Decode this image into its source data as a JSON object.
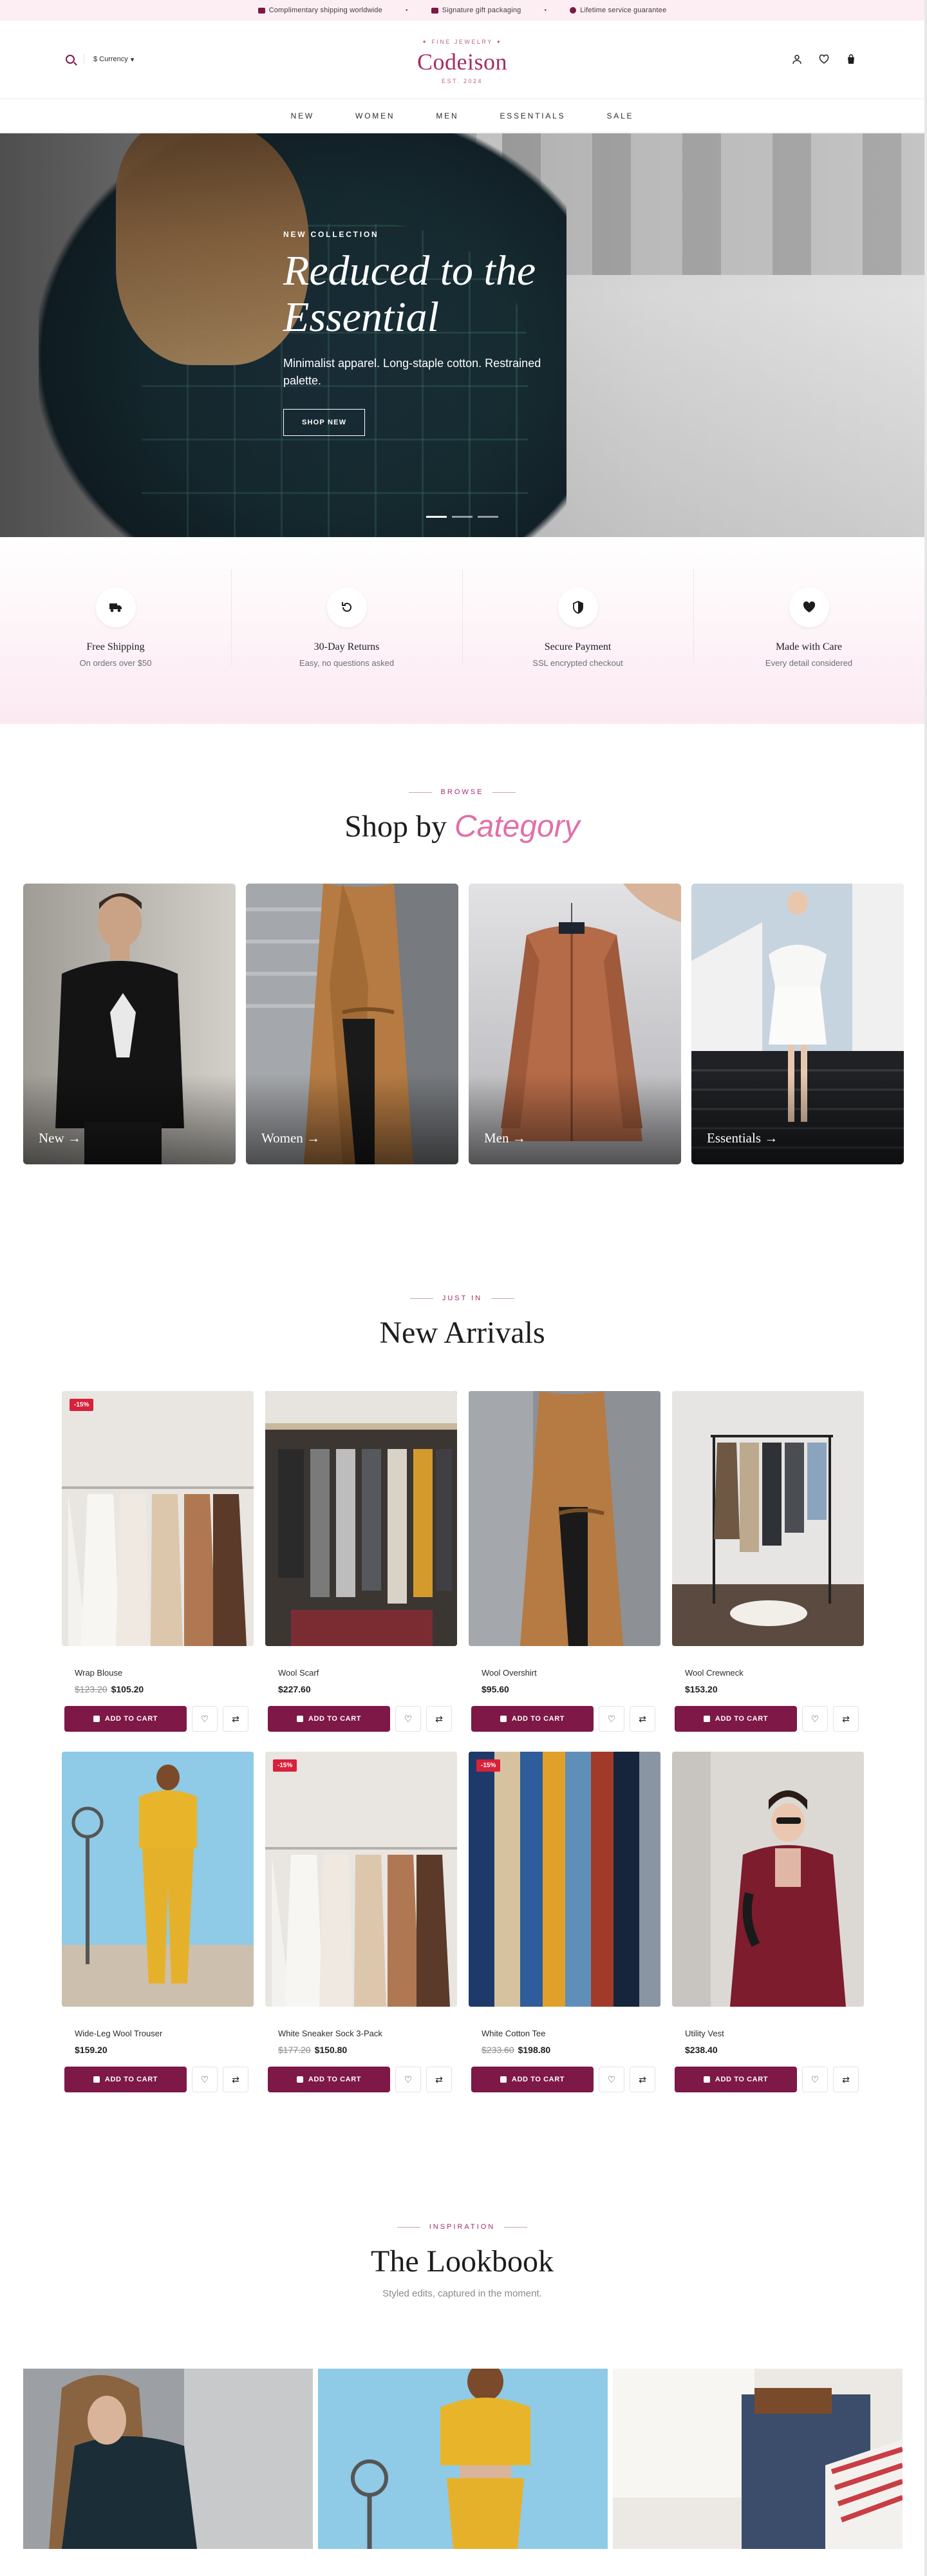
{
  "announcement": {
    "items": [
      {
        "icon": "truck-icon",
        "text": "Complimentary shipping worldwide"
      },
      {
        "icon": "gift-icon",
        "text": "Signature gift packaging"
      },
      {
        "icon": "heart-icon",
        "text": "Lifetime service guarantee"
      }
    ],
    "separator": "•"
  },
  "header": {
    "currency_label": "$ Currency",
    "brand_tag": "✦ FINE JEWELRY ✦",
    "brand_name": "Codeison",
    "brand_est": "EST. 2024",
    "icons": [
      "user-icon",
      "heart-icon",
      "bag-icon"
    ]
  },
  "nav": {
    "items": [
      "NEW",
      "WOMEN",
      "MEN",
      "ESSENTIALS",
      "SALE"
    ]
  },
  "hero": {
    "eyebrow": "NEW COLLECTION",
    "title_line1": "Reduced to the",
    "title_line2": "Essential",
    "description": "Minimalist apparel. Long-staple cotton. Restrained palette.",
    "cta": "SHOP NEW"
  },
  "features": [
    {
      "icon": "truck-icon",
      "title": "Free Shipping",
      "subtitle": "On orders over $50"
    },
    {
      "icon": "refresh-icon",
      "title": "30-Day Returns",
      "subtitle": "Easy, no questions asked"
    },
    {
      "icon": "shield-icon",
      "title": "Secure Payment",
      "subtitle": "SSL encrypted checkout"
    },
    {
      "icon": "heart-icon",
      "title": "Made with Care",
      "subtitle": "Every detail considered"
    }
  ],
  "categories_section": {
    "eyebrow": "BROWSE",
    "title_plain": "Shop by",
    "title_accent": "Category",
    "items": [
      {
        "label": "New →"
      },
      {
        "label": "Women →"
      },
      {
        "label": "Men →"
      },
      {
        "label": "Essentials →"
      }
    ]
  },
  "arrivals_section": {
    "eyebrow": "JUST IN",
    "title": "New Arrivals",
    "add_to_cart": "ADD TO CART",
    "products": [
      {
        "name": "Wrap Blouse",
        "old_price": "$123.20",
        "price": "$105.20",
        "badge": "-15%"
      },
      {
        "name": "Wool Scarf",
        "old_price": "",
        "price": "$227.60",
        "badge": ""
      },
      {
        "name": "Wool Overshirt",
        "old_price": "",
        "price": "$95.60",
        "badge": ""
      },
      {
        "name": "Wool Crewneck",
        "old_price": "",
        "price": "$153.20",
        "badge": ""
      },
      {
        "name": "Wide-Leg Wool Trouser",
        "old_price": "",
        "price": "$159.20",
        "badge": ""
      },
      {
        "name": "White Sneaker Sock 3-Pack",
        "old_price": "$177.20",
        "price": "$150.80",
        "badge": "-15%"
      },
      {
        "name": "White Cotton Tee",
        "old_price": "$233.60",
        "price": "$198.80",
        "badge": "-15%"
      },
      {
        "name": "Utility Vest",
        "old_price": "",
        "price": "$238.40",
        "badge": ""
      }
    ]
  },
  "lookbook_section": {
    "eyebrow": "INSPIRATION",
    "title": "The Lookbook",
    "subtitle": "Styled edits, captured in the moment."
  },
  "colors": {
    "accent": "#7d1847",
    "brand": "#a62c64",
    "highlight": "#e070a8",
    "sale_badge": "#d8213b",
    "announce_bg": "#fdeef4"
  }
}
